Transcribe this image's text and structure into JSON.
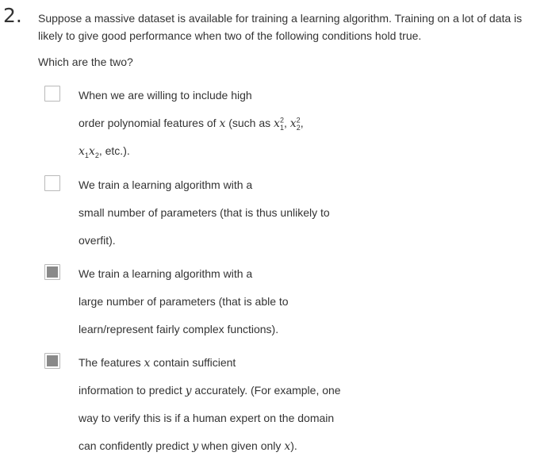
{
  "question": {
    "number": "2.",
    "prompt": "Suppose a massive dataset is available for training a learning algorithm. Training on a lot of data is likely to give good performance when two of the following conditions hold true.",
    "subprompt": "Which are the two?"
  },
  "options": [
    {
      "checked": false,
      "lines": [
        "When we are willing to include high",
        {
          "pre": "order polynomial features of ",
          "m1": "x",
          "mid": " (such as ",
          "m2": "x",
          "sub2": "1",
          "sup2": "2",
          "sep": ", ",
          "m3": "x",
          "sub3": "2",
          "sup3": "2",
          "post": ","
        },
        {
          "m1": "x",
          "sub1": "1",
          "m2": "x",
          "sub2": "2",
          "post": ", etc.)."
        }
      ]
    },
    {
      "checked": false,
      "lines": [
        "We train a learning algorithm with a",
        "small number of parameters (that is thus unlikely to",
        "overfit)."
      ]
    },
    {
      "checked": true,
      "lines": [
        "We train a learning algorithm with a",
        "large number of parameters (that is able to",
        "learn/represent fairly complex functions)."
      ]
    },
    {
      "checked": true,
      "lines": [
        {
          "pre": "The features ",
          "m1": "x",
          "post": " contain sufficient"
        },
        {
          "pre": "information to predict ",
          "m1": "y",
          "post": " accurately. (For example, one"
        },
        "way to verify this is if a human expert on the domain",
        {
          "pre": "can confidently predict ",
          "m1": "y",
          "mid": " when given only ",
          "m2": "x",
          "post": ")."
        }
      ]
    }
  ]
}
